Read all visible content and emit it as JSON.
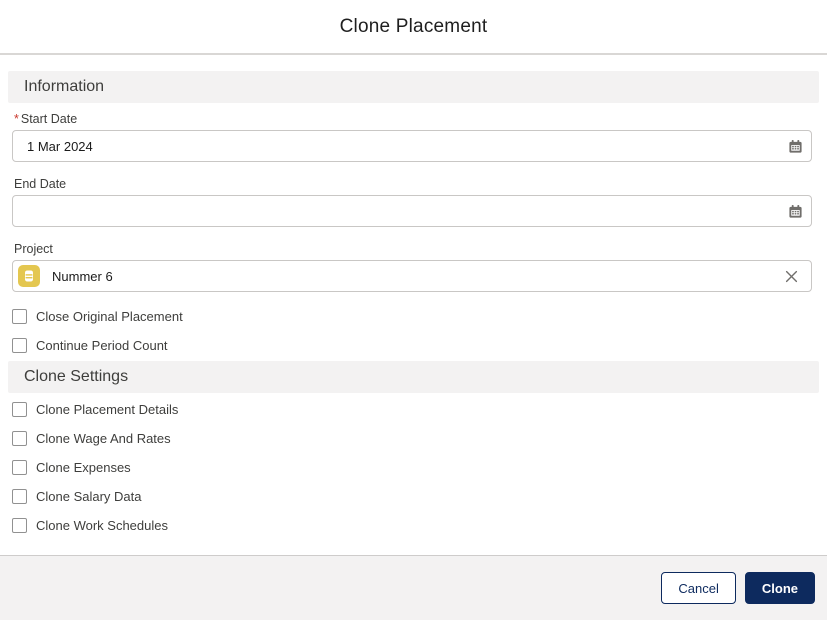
{
  "header": {
    "title": "Clone Placement"
  },
  "colors": {
    "accent_navy": "#0d2a5e",
    "required_red": "#c9372c",
    "section_bg": "#f3f2f2",
    "input_border": "#c9c7c5",
    "project_icon_yellow": "#e4c750",
    "icon_gray": "#706e6b"
  },
  "form": {
    "sections": {
      "information": "Information",
      "clone_settings": "Clone Settings"
    },
    "fields": {
      "start_date": {
        "label": "Start Date",
        "required_marker": "*",
        "value": "1 Mar 2024"
      },
      "end_date": {
        "label": "End Date",
        "value": ""
      },
      "project": {
        "label": "Project",
        "value": "Nummer 6"
      }
    },
    "icons": {
      "start_date": "calendar-icon",
      "end_date": "calendar-icon",
      "project_object": "project-record-icon",
      "project_clear": "clear-x-icon"
    },
    "checkboxes_information": [
      {
        "label": "Close Original Placement",
        "checked": false
      },
      {
        "label": "Continue Period Count",
        "checked": false
      }
    ],
    "checkboxes_clone_settings": [
      {
        "label": "Clone Placement Details",
        "checked": false
      },
      {
        "label": "Clone Wage And Rates",
        "checked": false
      },
      {
        "label": "Clone Expenses",
        "checked": false
      },
      {
        "label": "Clone Salary Data",
        "checked": false
      },
      {
        "label": "Clone Work Schedules",
        "checked": false
      }
    ]
  },
  "footer": {
    "cancel_label": "Cancel",
    "clone_label": "Clone"
  }
}
